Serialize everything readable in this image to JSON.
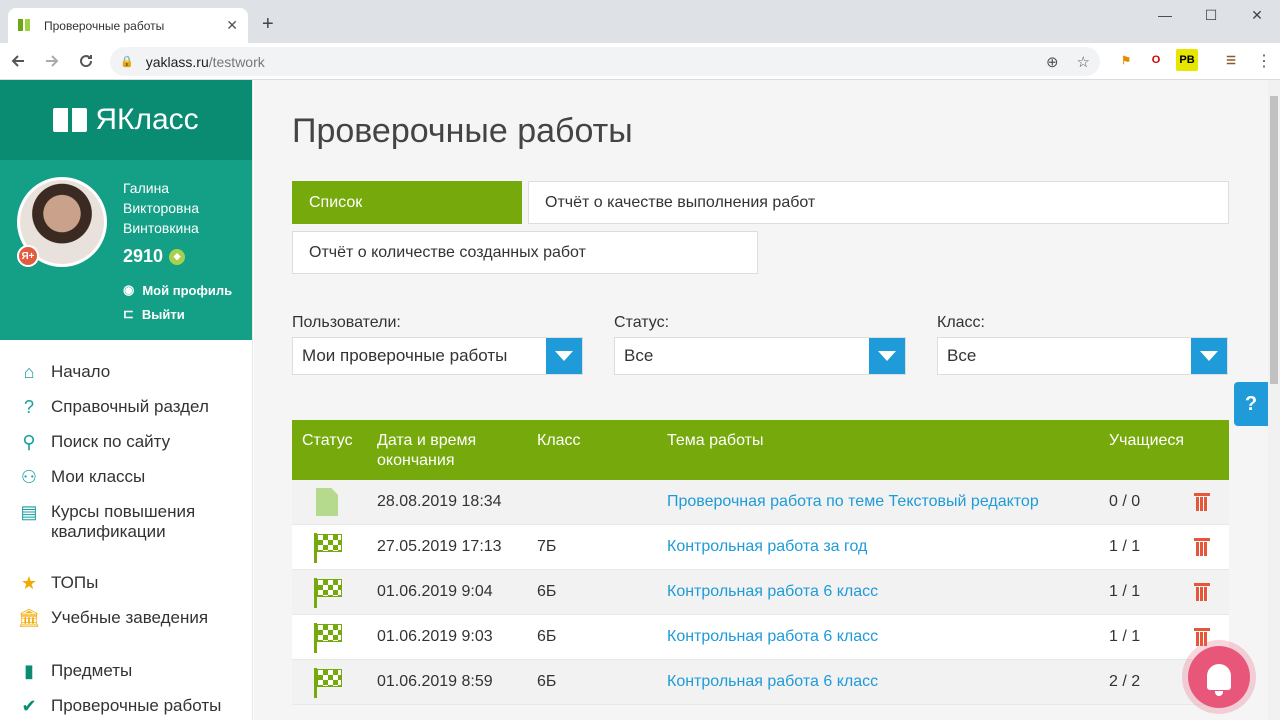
{
  "browser": {
    "tab_title": "Проверочные работы",
    "tab_close": "✕",
    "new_tab": "+",
    "url_host": "yaklass.ru",
    "url_path": "/testwork",
    "win_min": "—",
    "win_max": "☐",
    "win_close": "✕",
    "ext_c_label": "PB"
  },
  "sidebar": {
    "brand": "ЯКласс",
    "user_name": "Галина Викторовна Винтовкина",
    "badge": "Я+",
    "points": "2910",
    "gem_icon": "◆",
    "profile_link": "Мой профиль",
    "logout_link": "Выйти",
    "items": [
      {
        "label": "Начало",
        "icon": "⌂"
      },
      {
        "label": "Справочный раздел",
        "icon": "?"
      },
      {
        "label": "Поиск по сайту",
        "icon": "⚲"
      },
      {
        "label": "Мои классы",
        "icon": "⚇"
      },
      {
        "label": "Курсы повышения квалификации",
        "icon": "▤"
      },
      {
        "label": "ТОПы",
        "icon": "★"
      },
      {
        "label": "Учебные заведения",
        "icon": "🏛"
      },
      {
        "label": "Предметы",
        "icon": "▮"
      },
      {
        "label": "Проверочные работы",
        "icon": "✔"
      }
    ]
  },
  "main": {
    "title": "Проверочные работы",
    "tabs": [
      "Список",
      "Отчёт о качестве выполнения работ",
      "Отчёт о количестве созданных работ"
    ],
    "filters": [
      {
        "label": "Пользователи:",
        "value": "Мои проверочные работы"
      },
      {
        "label": "Статус:",
        "value": "Все"
      },
      {
        "label": "Класс:",
        "value": "Все"
      }
    ],
    "table": {
      "headers": [
        "Статус",
        "Дата и время окончания",
        "Класс",
        "Тема работы",
        "Учащиеся"
      ],
      "rows": [
        {
          "status": "draft",
          "date": "28.08.2019 18:34",
          "class": "",
          "topic": "Проверочная работа по теме Текстовый редактор",
          "students": "0 / 0"
        },
        {
          "status": "finished",
          "date": "27.05.2019 17:13",
          "class": "7Б",
          "topic": "Контрольная работа за год",
          "students": "1 / 1"
        },
        {
          "status": "finished",
          "date": "01.06.2019 9:04",
          "class": "6Б",
          "topic": "Контрольная работа 6 класс",
          "students": "1 / 1"
        },
        {
          "status": "finished",
          "date": "01.06.2019 9:03",
          "class": "6Б",
          "topic": "Контрольная работа 6 класс",
          "students": "1 / 1"
        },
        {
          "status": "finished",
          "date": "01.06.2019 8:59",
          "class": "6Б",
          "topic": "Контрольная работа 6 класс",
          "students": "2 / 2"
        }
      ]
    }
  },
  "help_label": "?",
  "colors": {
    "brand": "#0a8c73",
    "accent_green": "#76aa0c",
    "link_blue": "#1e9bd8",
    "delete_red": "#e4573b"
  }
}
